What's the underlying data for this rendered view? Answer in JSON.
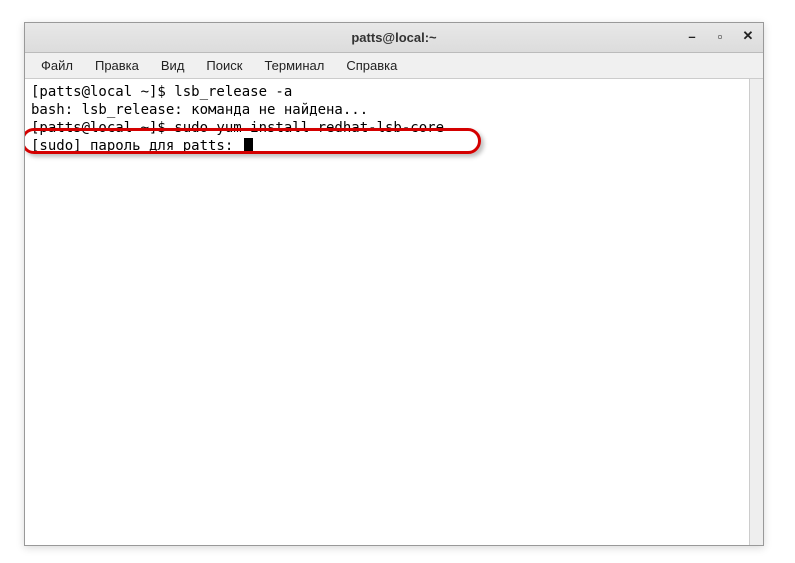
{
  "window": {
    "title": "patts@local:~"
  },
  "menubar": {
    "file": "Файл",
    "edit": "Правка",
    "view": "Вид",
    "search": "Поиск",
    "terminal": "Терминал",
    "help": "Справка"
  },
  "controls": {
    "minimize": "–",
    "maximize": "▫",
    "close": "✕"
  },
  "terminal": {
    "line1": "[patts@local ~]$ lsb_release -a",
    "line2": "bash: lsb_release: команда не найдена...",
    "line3": "[patts@local ~]$ sudo yum install redhat-lsb-core",
    "line4": "[sudo] пароль для patts: "
  }
}
